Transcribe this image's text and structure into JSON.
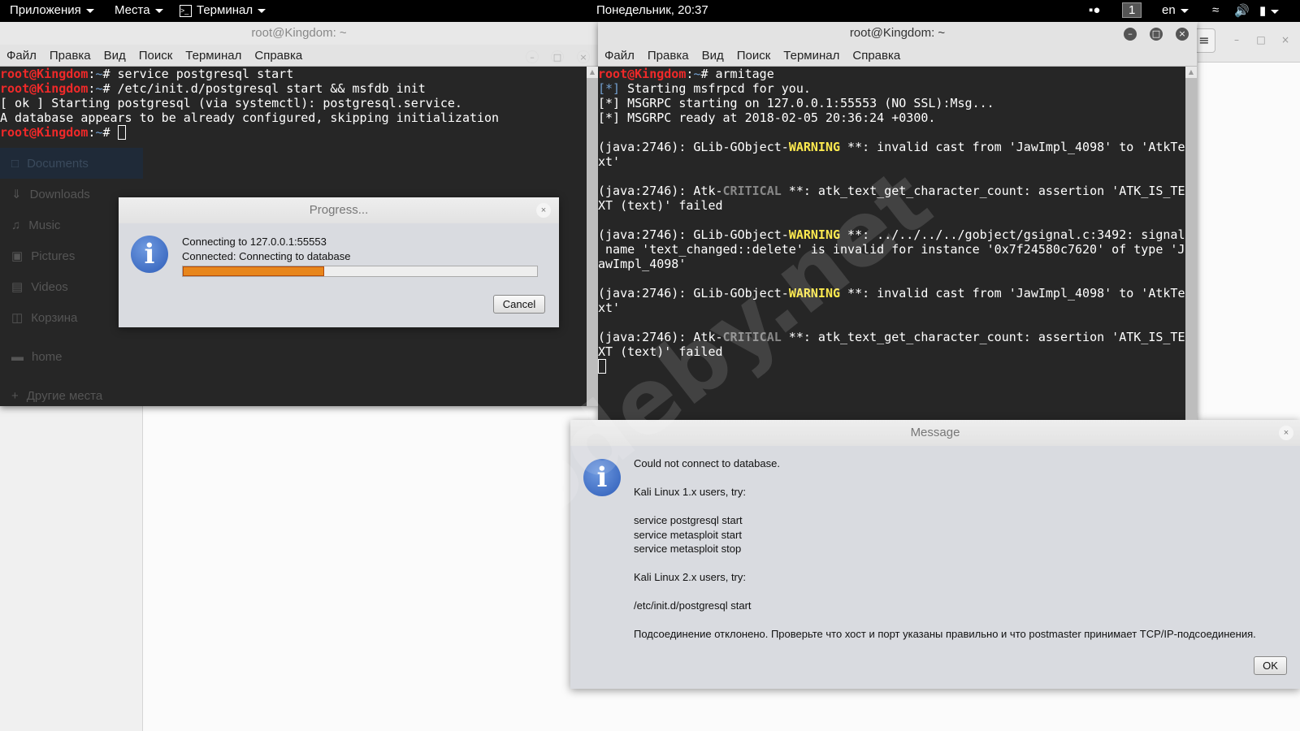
{
  "topbar": {
    "applications": "Приложения",
    "places": "Места",
    "terminal": "Терминал",
    "clock": "Понедельник, 20:37",
    "workspace": "1",
    "language": "en"
  },
  "files": {
    "sidebar": [
      "Documents",
      "Downloads",
      "Music",
      "Pictures",
      "Videos",
      "Корзина",
      "home",
      "Другие места"
    ],
    "menu_icon": "≡"
  },
  "terminal_left": {
    "title": "root@Kingdom: ~",
    "menu": [
      "Файл",
      "Правка",
      "Вид",
      "Поиск",
      "Терминал",
      "Справка"
    ],
    "prompt": "root@Kingdom",
    "lines": {
      "l1": "service postgresql start",
      "l2": "/etc/init.d/postgresql start && msfdb init",
      "l3": "[ ok ] Starting postgresql (via systemctl): postgresql.service.",
      "l4": "A database appears to be already configured, skipping initialization"
    }
  },
  "terminal_right": {
    "title": "root@Kingdom: ~",
    "menu": [
      "Файл",
      "Правка",
      "Вид",
      "Поиск",
      "Терминал",
      "Справка"
    ],
    "prompt": "root@Kingdom",
    "command": "armitage",
    "out1": " Starting msfrpcd for you.",
    "out2": "[*] MSGRPC starting on 127.0.0.1:55553 (NO SSL):Msg...",
    "out3": "[*] MSGRPC ready at 2018-02-05 20:36:24 +0300.",
    "warn": "WARNING",
    "crit": "CRITICAL"
  },
  "progress_dialog": {
    "title": "Progress...",
    "line1": "Connecting to 127.0.0.1:55553",
    "line2": "Connected: Connecting to database",
    "progress_percent": 40,
    "cancel": "Cancel"
  },
  "message_dialog": {
    "title": "Message",
    "lines": [
      "Could not connect to database.",
      "",
      "Kali Linux 1.x users, try:",
      "",
      "service postgresql start",
      "service metasploit start",
      "service metasploit stop",
      "",
      "Kali Linux 2.x users, try:",
      "",
      "/etc/init.d/postgresql start",
      "",
      "Подсоединение отклонено. Проверьте что хост и порт указаны правильно и что postmaster принимает TCP/IP-подсоединения."
    ],
    "ok": "OK"
  },
  "watermark": "codeby.net"
}
